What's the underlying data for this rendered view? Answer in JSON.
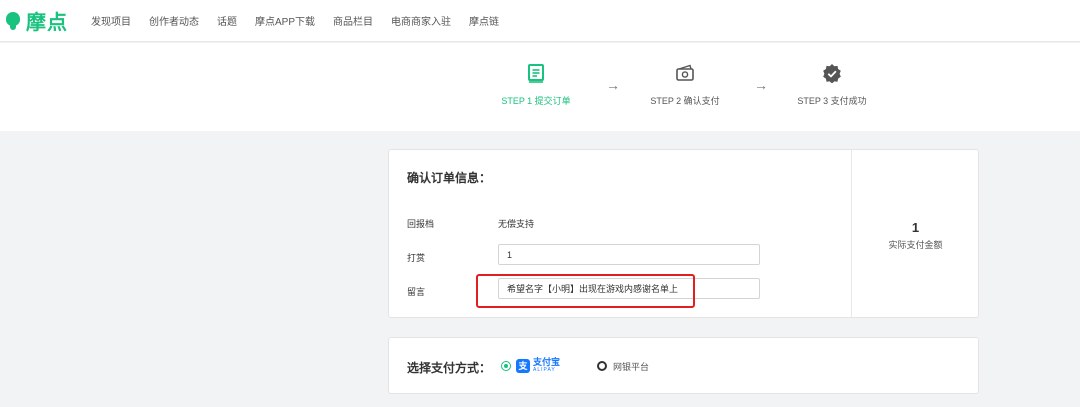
{
  "header": {
    "logo_text": "摩点",
    "nav": [
      "发现项目",
      "创作者动态",
      "话题",
      "摩点APP下载",
      "商品栏目",
      "电商商家入驻",
      "摩点链"
    ]
  },
  "steps": [
    {
      "label": "STEP 1 提交订单",
      "icon": "document-icon",
      "active": true
    },
    {
      "label": "STEP 2 确认支付",
      "icon": "money-icon",
      "active": false
    },
    {
      "label": "STEP 3 支付成功",
      "icon": "check-badge-icon",
      "active": false
    }
  ],
  "order": {
    "title": "确认订单信息：",
    "reward_label": "回报档",
    "reward_value": "无偿支持",
    "tip_label": "打赏",
    "tip_value": "1",
    "message_label": "留言",
    "message_value": "希望名字【小明】出现在游戏内感谢名单上",
    "amount_value": "1",
    "amount_caption": "实际支付金额"
  },
  "payment": {
    "title": "选择支付方式：",
    "alipay_name": "支付宝",
    "alipay_en": "ALIPAY",
    "alipay_glyph": "支",
    "bank_label": "网银平台",
    "selected": "alipay"
  },
  "colors": {
    "accent": "#19c27e",
    "highlight_border": "#e02020",
    "alipay_blue": "#1677ff"
  }
}
